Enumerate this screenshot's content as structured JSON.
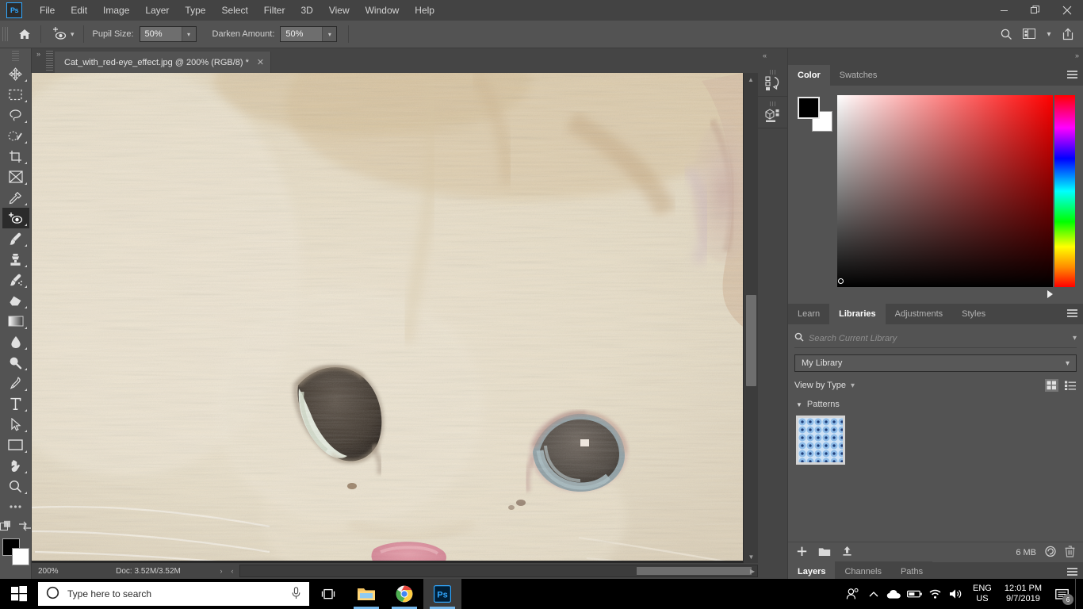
{
  "app": {
    "name": "Adobe Photoshop",
    "logo_text": "Ps"
  },
  "menubar": {
    "items": [
      "File",
      "Edit",
      "Image",
      "Layer",
      "Type",
      "Select",
      "Filter",
      "3D",
      "View",
      "Window",
      "Help"
    ],
    "window_controls": {
      "minimize": "—",
      "restore": "❐",
      "close": "✕"
    }
  },
  "options_bar": {
    "home_icon": "home-icon",
    "tool_icon": "red-eye-tool-icon",
    "pupil_size": {
      "label": "Pupil Size:",
      "value": "50%"
    },
    "darken_amount": {
      "label": "Darken Amount:",
      "value": "50%"
    },
    "right_icons": [
      "search-icon",
      "workspace-icon",
      "chevron-down-icon",
      "share-icon"
    ]
  },
  "toolbar": {
    "tools": [
      {
        "name": "move-tool",
        "active": false
      },
      {
        "name": "rectangular-marquee-tool",
        "active": false
      },
      {
        "name": "lasso-tool",
        "active": false
      },
      {
        "name": "quick-selection-tool",
        "active": false
      },
      {
        "name": "crop-tool",
        "active": false
      },
      {
        "name": "frame-tool",
        "active": false
      },
      {
        "name": "eyedropper-tool",
        "active": false
      },
      {
        "name": "red-eye-tool",
        "active": true
      },
      {
        "name": "brush-tool",
        "active": false
      },
      {
        "name": "clone-stamp-tool",
        "active": false
      },
      {
        "name": "history-brush-tool",
        "active": false
      },
      {
        "name": "eraser-tool",
        "active": false
      },
      {
        "name": "gradient-tool",
        "active": false
      },
      {
        "name": "blur-tool",
        "active": false
      },
      {
        "name": "dodge-tool",
        "active": false
      },
      {
        "name": "pen-tool",
        "active": false
      },
      {
        "name": "type-tool",
        "active": false
      },
      {
        "name": "path-selection-tool",
        "active": false
      },
      {
        "name": "rectangle-tool",
        "active": false
      },
      {
        "name": "hand-tool",
        "active": false
      },
      {
        "name": "zoom-tool",
        "active": false
      },
      {
        "name": "edit-toolbar-tool",
        "active": false
      }
    ],
    "foreground_color": "#000000",
    "background_color": "#ffffff"
  },
  "document": {
    "tab_title": "Cat_with_red-eye_effect.jpg @ 200% (RGB/8) *",
    "close_label": "✕"
  },
  "status_bar": {
    "zoom": "200%",
    "doc_info": "Doc: 3.52M/3.52M",
    "next_caret": "›",
    "prev_caret": "‹"
  },
  "dock_icons": [
    {
      "name": "history-panel-icon"
    },
    {
      "name": "3d-panel-icon"
    }
  ],
  "color_panel": {
    "tabs": [
      {
        "label": "Color",
        "active": true
      },
      {
        "label": "Swatches",
        "active": false
      }
    ],
    "menu_icon": "panel-menu-icon",
    "foreground": "#000000",
    "background": "#ffffff",
    "spectrum_accent": "#ff0000"
  },
  "libraries_panel": {
    "tabs": [
      {
        "label": "Learn",
        "active": false
      },
      {
        "label": "Libraries",
        "active": true
      },
      {
        "label": "Adjustments",
        "active": false
      },
      {
        "label": "Styles",
        "active": false
      }
    ],
    "menu_icon": "panel-menu-icon",
    "search": {
      "placeholder": "Search Current Library",
      "icon": "search-icon",
      "chevron": "chevron-down-icon"
    },
    "library_select": {
      "value": "My Library",
      "chevron": "⌄"
    },
    "view_by": {
      "label": "View by Type",
      "chevron": "⌄"
    },
    "view_modes": [
      {
        "name": "grid-view-icon",
        "selected": true
      },
      {
        "name": "list-view-icon",
        "selected": false
      }
    ],
    "groups": [
      {
        "label": "Patterns",
        "expanded": true,
        "disclosure": "▼",
        "items": [
          {
            "name": "blue-dot-pattern-thumbnail"
          }
        ]
      }
    ],
    "footer": {
      "add_icon": "add-content-icon",
      "folder_icon": "new-group-icon",
      "upload_icon": "upload-icon",
      "size_label": "6 MB",
      "sync_icon": "creative-cloud-sync-icon",
      "delete_icon": "trash-icon"
    }
  },
  "layers_panel": {
    "tabs": [
      {
        "label": "Layers",
        "active": true
      },
      {
        "label": "Channels",
        "active": false
      },
      {
        "label": "Paths",
        "active": false
      }
    ],
    "menu_icon": "panel-menu-icon"
  },
  "canvas": {
    "image_description": "Close-up photograph of a cream colored cat face with two eyes, red-eye effect corrected",
    "zoom_level": "200%"
  },
  "taskbar": {
    "start_icon": "windows-start-icon",
    "search_placeholder": "Type here to search",
    "cortana_icon": "cortana-icon",
    "microphone_icon": "microphone-icon",
    "task_view_icon": "task-view-icon",
    "apps": [
      {
        "name": "file-explorer-icon",
        "running": true,
        "active": false
      },
      {
        "name": "google-chrome-icon",
        "running": true,
        "active": false
      },
      {
        "name": "photoshop-taskbar-icon",
        "running": true,
        "active": true
      }
    ],
    "tray": {
      "people_icon": "people-icon",
      "show_hidden_icon": "chevron-up-icon",
      "onedrive_icon": "onedrive-icon",
      "battery_icon": "battery-icon",
      "network_icon": "wifi-icon",
      "volume_icon": "volume-icon",
      "language": "ENG",
      "region": "US",
      "time": "12:01 PM",
      "date": "9/7/2019",
      "notification_icon": "action-center-icon",
      "notification_count": "6"
    }
  }
}
